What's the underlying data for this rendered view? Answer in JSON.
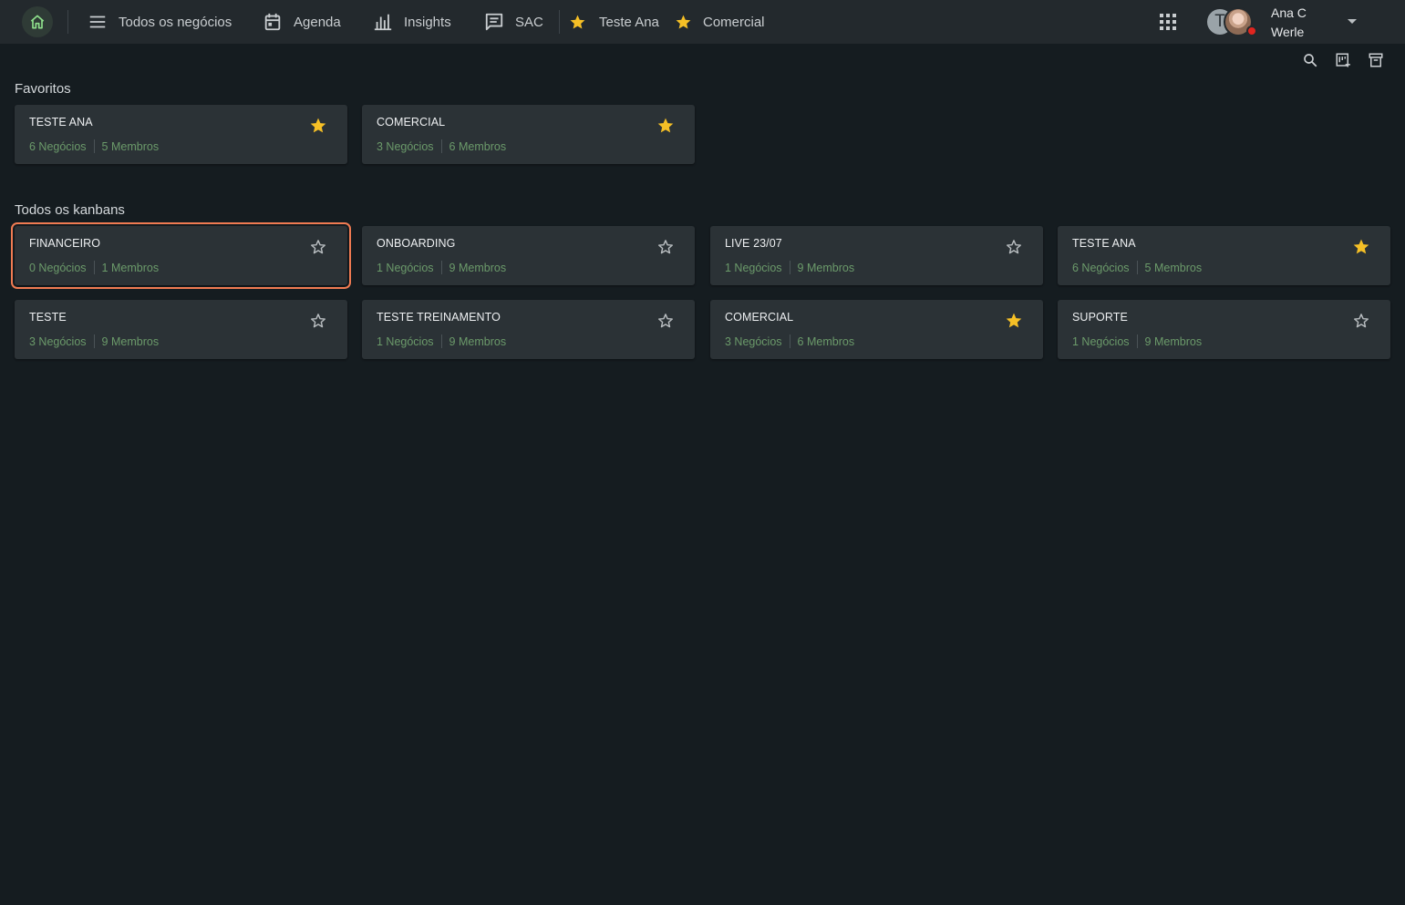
{
  "topbar": {
    "nav": [
      {
        "label": "Todos os negócios",
        "icon": "menu-icon"
      },
      {
        "label": "Agenda",
        "icon": "calendar-icon"
      },
      {
        "label": "Insights",
        "icon": "bar-chart-icon"
      },
      {
        "label": "SAC",
        "icon": "chat-icon"
      }
    ],
    "favorites": [
      {
        "label": "Teste Ana",
        "icon": "star-filled-icon"
      },
      {
        "label": "Comercial",
        "icon": "star-filled-icon"
      }
    ],
    "user": {
      "initial": "T",
      "name_line1": "Ana C",
      "name_line2": "Werle",
      "status_color": "#e0251f"
    }
  },
  "colors": {
    "accent_star": "#f6c026",
    "selected_outline": "#f07b52",
    "meta_text": "#6b9a6a"
  },
  "favoritos": {
    "title": "Favoritos",
    "cards": [
      {
        "title": "TESTE ANA",
        "negocios": "6 Negócios",
        "membros": "5 Membros",
        "favorite": true
      },
      {
        "title": "COMERCIAL",
        "negocios": "3 Negócios",
        "membros": "6 Membros",
        "favorite": true
      }
    ]
  },
  "kanbans": {
    "title": "Todos os kanbans",
    "cards": [
      {
        "title": "FINANCEIRO",
        "negocios": "0 Negócios",
        "membros": "1 Membros",
        "favorite": false,
        "selected": true
      },
      {
        "title": "ONBOARDING",
        "negocios": "1 Negócios",
        "membros": "9 Membros",
        "favorite": false
      },
      {
        "title": "LIVE 23/07",
        "negocios": "1 Negócios",
        "membros": "9 Membros",
        "favorite": false
      },
      {
        "title": "TESTE ANA",
        "negocios": "6 Negócios",
        "membros": "5 Membros",
        "favorite": true
      },
      {
        "title": "TESTE",
        "negocios": "3 Negócios",
        "membros": "9 Membros",
        "favorite": false
      },
      {
        "title": "TESTE TREINAMENTO",
        "negocios": "1 Negócios",
        "membros": "9 Membros",
        "favorite": false
      },
      {
        "title": "COMERCIAL",
        "negocios": "3 Negócios",
        "membros": "6 Membros",
        "favorite": true
      },
      {
        "title": "SUPORTE",
        "negocios": "1 Negócios",
        "membros": "9 Membros",
        "favorite": false
      }
    ]
  }
}
